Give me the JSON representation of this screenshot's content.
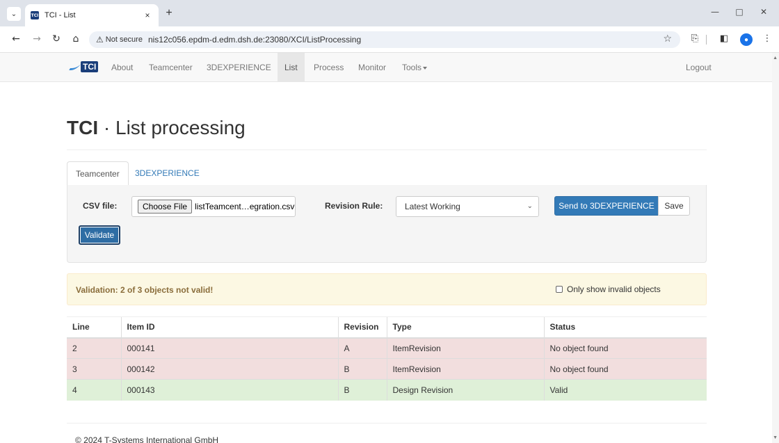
{
  "browser": {
    "tab_title": "TCI - List",
    "favicon_text": "TCI",
    "new_tab_symbol": "+",
    "close_symbol": "×",
    "not_secure": "Not secure",
    "url": "nis12c056.epdm-d.edm.dsh.de:23080/XCI/ListProcessing"
  },
  "navbar": {
    "brand": "TCI",
    "items": [
      {
        "label": "About",
        "active": false
      },
      {
        "label": "Teamcenter",
        "active": false
      },
      {
        "label": "3DEXPERIENCE",
        "active": false
      },
      {
        "label": "List",
        "active": true
      },
      {
        "label": "Process",
        "active": false
      },
      {
        "label": "Monitor",
        "active": false
      },
      {
        "label": "Tools",
        "active": false
      }
    ],
    "logout": "Logout"
  },
  "page": {
    "title_bold": "TCI",
    "title_rest": " · List processing"
  },
  "tabs": [
    {
      "label": "Teamcenter",
      "active": true
    },
    {
      "label": "3DEXPERIENCE",
      "active": false
    }
  ],
  "form": {
    "csv_label": "CSV file:",
    "choose_file": "Choose File",
    "file_name": "listTeamcent…egration.csv",
    "revision_rule_label": "Revision Rule:",
    "revision_rule_value": "Latest Working",
    "send_button": "Send to 3DEXPERIENCE",
    "save_button": "Save",
    "validate_button": "Validate"
  },
  "alert": {
    "message": "Validation: 2 of 3 objects not valid!",
    "checkbox_label": "Only show invalid objects",
    "checkbox_checked": false
  },
  "table": {
    "headers": [
      "Line",
      "Item ID",
      "Revision",
      "Type",
      "Status"
    ],
    "rows": [
      {
        "line": "2",
        "item_id": "000141",
        "revision": "A",
        "type": "ItemRevision",
        "status": "No object found",
        "state": "invalid"
      },
      {
        "line": "3",
        "item_id": "000142",
        "revision": "B",
        "type": "ItemRevision",
        "status": "No object found",
        "state": "invalid"
      },
      {
        "line": "4",
        "item_id": "000143",
        "revision": "B",
        "type": "Design Revision",
        "status": "Valid",
        "state": "valid"
      }
    ]
  },
  "footer": {
    "copyright": "© 2024 T-Systems International GmbH"
  },
  "colors": {
    "primary": "#337ab7",
    "danger_row": "#f2dede",
    "success_row": "#dff0d8",
    "warning_bg": "#fcf8e3",
    "warning_text": "#8a6d3b"
  },
  "icons": [
    "tab-search-icon",
    "back-icon",
    "forward-icon",
    "reload-icon",
    "home-icon",
    "warning-icon",
    "bookmark-star-icon",
    "extensions-icon",
    "side-panel-icon",
    "profile-icon",
    "menu-icon",
    "minimize-icon",
    "maximize-icon",
    "close-window-icon"
  ]
}
